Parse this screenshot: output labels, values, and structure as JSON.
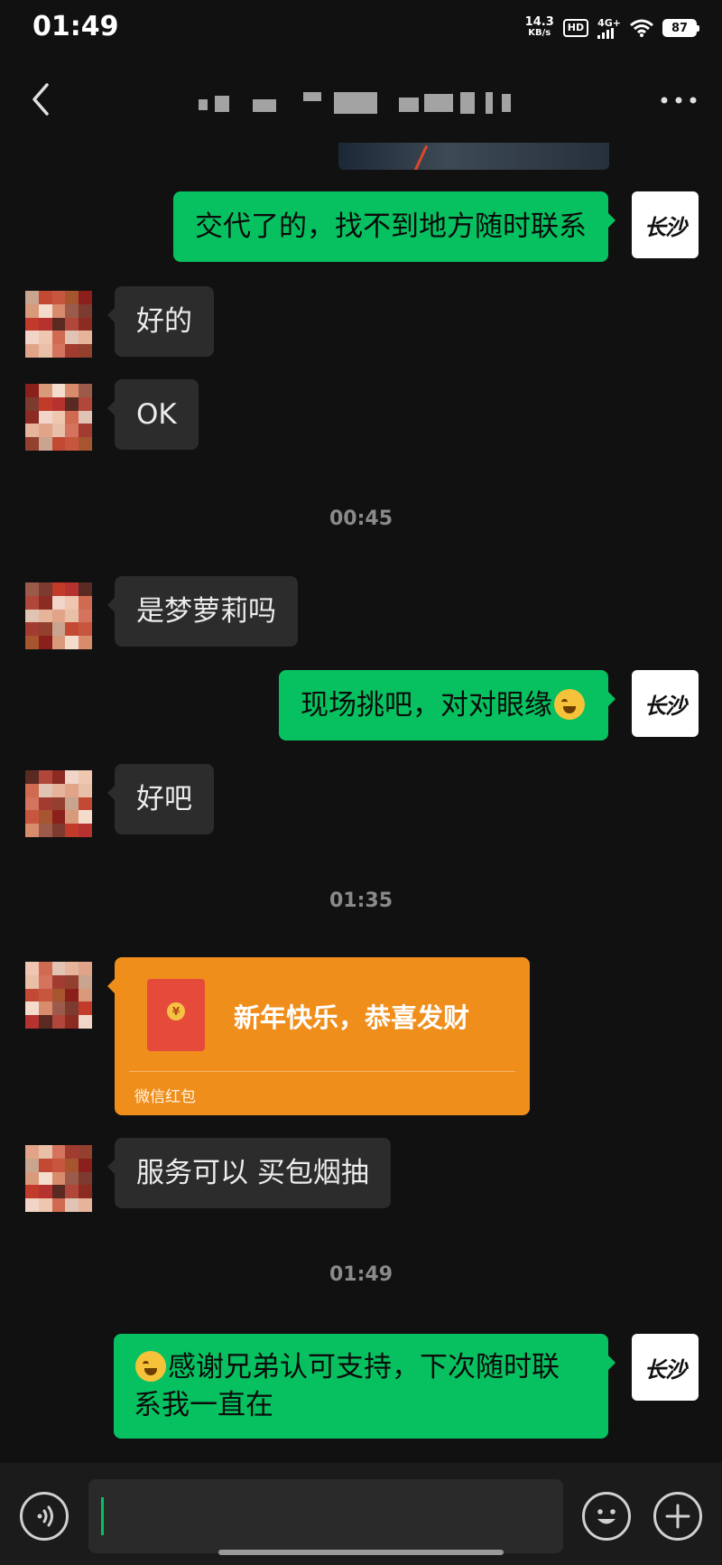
{
  "status_bar": {
    "time": "01:49",
    "net_speed_value": "14.3",
    "net_speed_unit": "KB/s",
    "hd_badge": "HD",
    "network_type": "4G+",
    "battery": "87"
  },
  "header": {
    "title": "",
    "back_icon": "chevron-left-icon",
    "more_icon": "more-dots-icon"
  },
  "self_avatar_text": "长沙",
  "messages": [
    {
      "sender": "self",
      "text": "交代了的，找不到地方随时联系"
    },
    {
      "sender": "other",
      "text": "好的"
    },
    {
      "sender": "other",
      "text": "OK"
    },
    {
      "type": "timestamp",
      "text": "00:45"
    },
    {
      "sender": "other",
      "text": "是梦萝莉吗"
    },
    {
      "sender": "self",
      "text": "现场挑吧，对对眼缘",
      "emoji": "grinning-sweat-face"
    },
    {
      "sender": "other",
      "text": "好吧"
    },
    {
      "type": "timestamp",
      "text": "01:35"
    },
    {
      "sender": "other",
      "type": "red_packet",
      "text": "新年快乐，恭喜发财",
      "label": "微信红包",
      "coin": "¥"
    },
    {
      "sender": "other",
      "text": "服务可以 买包烟抽"
    },
    {
      "type": "timestamp",
      "text": "01:49"
    },
    {
      "sender": "self",
      "text_line1": "感谢兄弟认可支持，下次随时联",
      "text_line2": "系我一直在",
      "emoji": "tongue-face"
    }
  ],
  "input_bar": {
    "voice_icon": "voice-icon",
    "emoji_icon": "emoji-icon",
    "plus_icon": "plus-icon",
    "input_value": ""
  },
  "colors": {
    "background": "#111111",
    "incoming_bubble": "#2c2c2c",
    "outgoing_bubble": "#07c160",
    "red_packet": "#f08e1c"
  }
}
